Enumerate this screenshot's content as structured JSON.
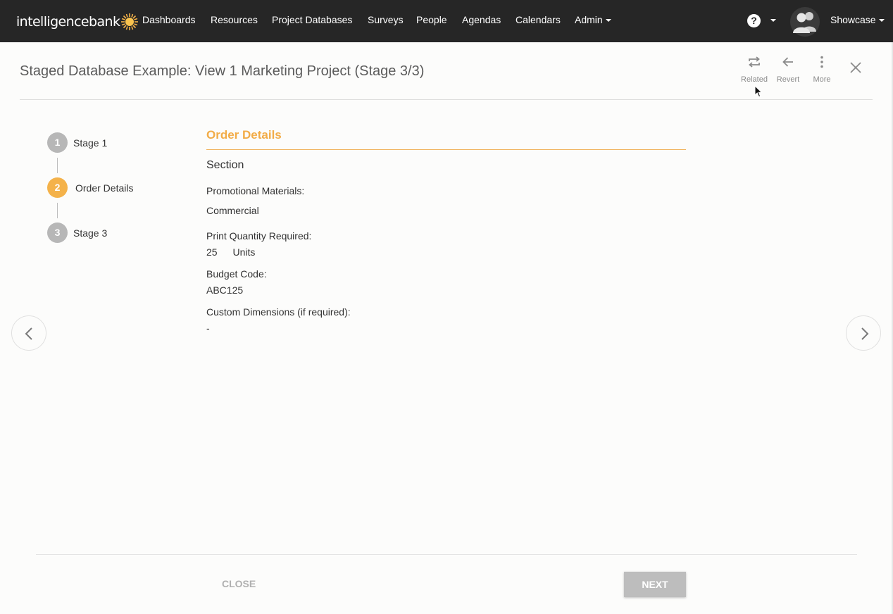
{
  "nav": {
    "logo_text": "intelligencebank",
    "items": [
      "Dashboards",
      "Resources",
      "Project Databases",
      "Surveys",
      "People",
      "Agendas",
      "Calendars",
      "Admin"
    ],
    "help_glyph": "?",
    "user_name": "Showcase",
    "icons": [
      "sun-logo-icon",
      "help-icon",
      "avatar-icon",
      "caret-down-icon"
    ]
  },
  "header": {
    "title": "Staged Database Example: View 1 Marketing Project (Stage 3/3)",
    "actions": [
      {
        "label": "Related",
        "icon": "repeat-icon"
      },
      {
        "label": "Revert",
        "icon": "arrow-left-icon"
      },
      {
        "label": "More",
        "icon": "more-vertical-icon"
      }
    ],
    "close_icon": "close-icon"
  },
  "stepper": {
    "steps": [
      {
        "number": "1",
        "label": "Stage 1",
        "active": false
      },
      {
        "number": "2",
        "label": "Order Details",
        "active": true
      },
      {
        "number": "3",
        "label": "Stage 3",
        "active": false
      }
    ]
  },
  "content": {
    "heading": "Order Details",
    "section_title": "Section",
    "fields": [
      {
        "label": "Promotional Materials:",
        "value": "Commercial"
      },
      {
        "label": "Print Quantity Required:",
        "value": "25",
        "unit": "Units"
      },
      {
        "label": "Budget Code:",
        "value": "ABC125"
      },
      {
        "label": "Custom Dimensions (if required):",
        "value": "-"
      }
    ]
  },
  "footer": {
    "close_label": "CLOSE",
    "next_label": "NEXT"
  },
  "colors": {
    "nav_bg": "#262626",
    "accent": "#f4b24a",
    "step_inactive": "#b7b7b7",
    "button_disabled": "#bdbdbd"
  }
}
